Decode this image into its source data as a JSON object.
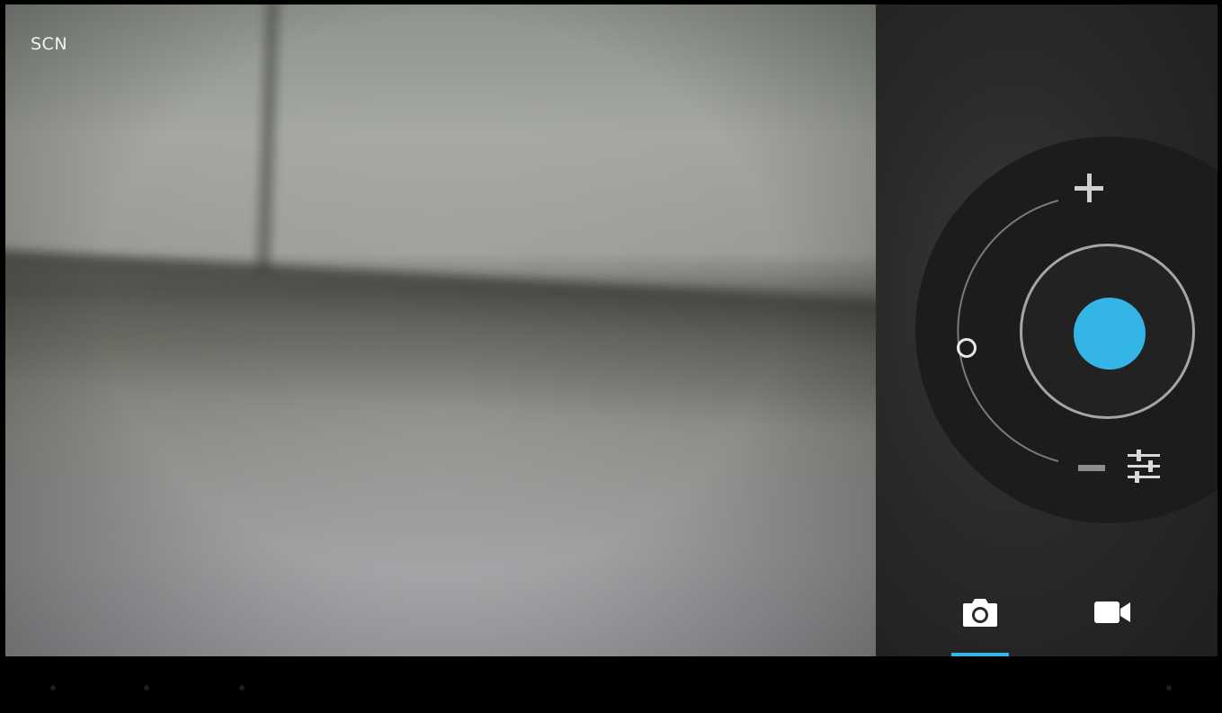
{
  "viewfinder": {
    "scene_mode_label": "SCN"
  },
  "controls": {
    "zoom_in_icon": "plus-icon",
    "zoom_out_icon": "minus-icon",
    "zoom_level": 0.5,
    "settings_icon": "sliders-icon",
    "shutter_color": "#33b5e5"
  },
  "modes": {
    "items": [
      {
        "icon": "camera-icon",
        "selected": true
      },
      {
        "icon": "video-camera-icon",
        "selected": false
      }
    ],
    "accent": "#33b5e5"
  },
  "navigation_bar": {
    "icons": [
      "back-icon",
      "home-icon",
      "recent-apps-icon",
      "menu-icon"
    ]
  }
}
